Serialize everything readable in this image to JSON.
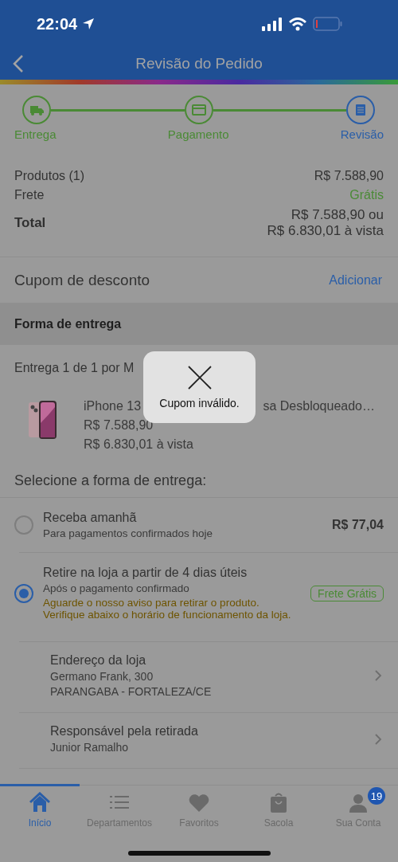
{
  "status_bar": {
    "time": "22:04"
  },
  "nav": {
    "title": "Revisão do Pedido"
  },
  "steps": [
    {
      "label": "Entrega",
      "completed": true,
      "current": false
    },
    {
      "label": "Pagamento",
      "completed": true,
      "current": false
    },
    {
      "label": "Revisão",
      "completed": false,
      "current": true
    }
  ],
  "summary": [
    {
      "kind": "plain",
      "label": "Produtos (1)",
      "values": [
        "R$ 7.588,90"
      ]
    },
    {
      "kind": "free",
      "label": "Frete",
      "values": [
        "Grátis"
      ]
    },
    {
      "kind": "total",
      "label": "Total",
      "values": [
        "R$ 7.588,90 ou",
        "R$ 6.830,01 à vista"
      ]
    }
  ],
  "coupon": {
    "label": "Cupom de desconto",
    "action": "Adicionar"
  },
  "delivery_section": {
    "title": "Forma de entrega"
  },
  "shipment": {
    "heading": "Entrega 1 de 1 por M",
    "product": {
      "kind": "picture",
      "name_parts": [
        "iPhone 13",
        "sa Desbloqueado…"
      ],
      "price": "R$ 7.588,90",
      "cash_price": "R$ 6.830,01 à vista"
    }
  },
  "select_title": "Selecione a forma de entrega:",
  "options": [
    {
      "title": "Receba amanhã",
      "subtitle": "Para pagamentos confirmados hoje",
      "price": "R$ 77,04",
      "selected": false
    },
    {
      "title": "Retire na loja a partir de 4 dias úteis",
      "subtitle": "Após o pagamento confirmado",
      "note": "Aguarde o nosso aviso para retirar o produto. Verifique abaixo o horário de funcionamento da loja.",
      "badge": "Frete Grátis",
      "selected": true
    }
  ],
  "details": [
    {
      "title": "Endereço da loja",
      "lines": [
        "Germano Frank, 300",
        "PARANGABA - FORTALEZA/CE"
      ]
    },
    {
      "title": "Responsável pela retirada",
      "lines": [
        "Junior Ramalho"
      ]
    }
  ],
  "tabs": [
    {
      "label": "Início",
      "selected": true
    },
    {
      "label": "Departamentos",
      "selected": false
    },
    {
      "label": "Favoritos",
      "selected": false
    },
    {
      "label": "Sacola",
      "selected": false
    },
    {
      "label": "Sua Conta",
      "selected": false,
      "badge": "19"
    }
  ],
  "toast": {
    "message": "Cupom inválido."
  }
}
